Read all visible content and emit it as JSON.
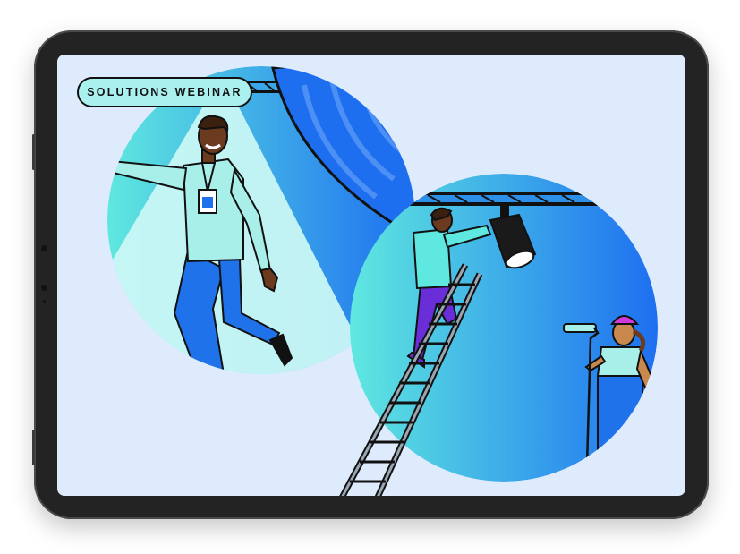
{
  "badge": {
    "label": "SOLUTIONS WEBINAR"
  },
  "colors": {
    "screen_bg": "#deebfd",
    "badge_bg": "#a9f0ee",
    "gradient_start": "#5fe8df",
    "gradient_end": "#1e6ff0",
    "spotlight": "#c9f7f4",
    "shirt_teal": "#a8efea",
    "pants_blue": "#1f72ea",
    "pants_purple": "#6a2ed9",
    "helmet_pink": "#d03ad8",
    "skin": "#6b3a1f",
    "bezel": "#232323"
  },
  "icons": [
    "stage-light-icon",
    "paint-roller-icon",
    "id-badge-icon",
    "ladder-icon",
    "curtain-icon",
    "truss-icon"
  ]
}
